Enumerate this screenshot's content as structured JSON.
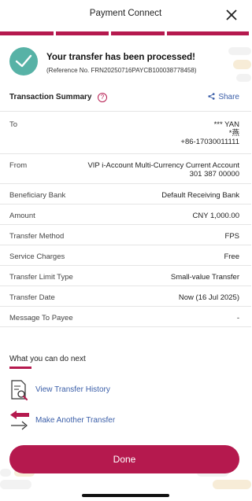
{
  "header": {
    "title": "Payment Connect"
  },
  "success": {
    "title": "Your transfer has been processed!",
    "reference": "(Reference No. FRN20250716PAYCB100038778458)"
  },
  "summary": {
    "title": "Transaction Summary",
    "help_glyph": "?",
    "share_label": "Share"
  },
  "details": {
    "to": {
      "label": "To",
      "name": "*** YAN",
      "name2": "*燕",
      "account": "+86-17030011111"
    },
    "from": {
      "label": "From",
      "account_name": "VIP i-Account Multi-Currency Current Account",
      "account_no": "301 387 00000"
    },
    "beneficiary_bank": {
      "label": "Beneficiary Bank",
      "value": "Default Receiving Bank"
    },
    "amount": {
      "label": "Amount",
      "value": "CNY 1,000.00"
    },
    "transfer_method": {
      "label": "Transfer Method",
      "value": "FPS"
    },
    "service_charges": {
      "label": "Service Charges",
      "value": "Free"
    },
    "transfer_limit_type": {
      "label": "Transfer Limit Type",
      "value": "Small-value Transfer"
    },
    "transfer_date": {
      "label": "Transfer Date",
      "value": "Now (16 Jul 2025)"
    },
    "message_to_payee": {
      "label": "Message To Payee",
      "value": "-"
    }
  },
  "next": {
    "title": "What you can do next",
    "view_history": "View Transfer History",
    "another_transfer": "Make Another Transfer"
  },
  "done_label": "Done",
  "colors": {
    "brand": "#b5194e",
    "success": "#57b2a6",
    "link": "#3a5ea8"
  },
  "icons": {
    "close": "close-icon",
    "check": "checkmark-icon",
    "help": "help-icon",
    "share": "share-icon",
    "history": "document-search-icon",
    "transfer": "transfer-arrows-icon"
  }
}
